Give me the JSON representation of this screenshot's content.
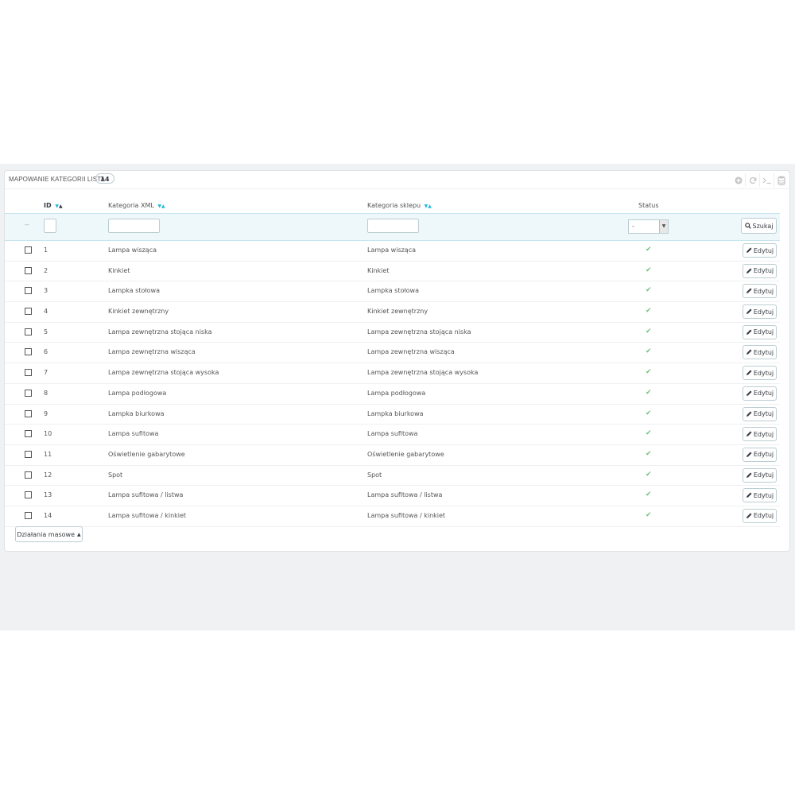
{
  "panel": {
    "title": "Mapowanie kategorii Lista",
    "count": "14"
  },
  "toolbar": {
    "icons": [
      "add-icon",
      "refresh-icon",
      "sql-terminal-icon",
      "database-icon"
    ]
  },
  "columns": {
    "id": "ID",
    "xml": "Kategoria XML",
    "shop": "Kategoria sklepu",
    "status": "Status"
  },
  "filters": {
    "dash": "--",
    "status_value": "-",
    "search_label": "Szukaj"
  },
  "edit_label": "Edytuj",
  "bulk_label": "Działania masowe",
  "colors": {
    "accent": "#25b9d7",
    "status_ok": "#72c279",
    "filter_bg": "#eef8fb"
  },
  "rows": [
    {
      "id": "1",
      "xml": "Lampa wisząca",
      "shop": "Lampa wisząca"
    },
    {
      "id": "2",
      "xml": "Kinkiet",
      "shop": "Kinkiet"
    },
    {
      "id": "3",
      "xml": "Lampka stołowa",
      "shop": "Lampka stołowa"
    },
    {
      "id": "4",
      "xml": "Kinkiet zewnętrzny",
      "shop": "Kinkiet zewnętrzny"
    },
    {
      "id": "5",
      "xml": "Lampa zewnętrzna stojąca niska",
      "shop": "Lampa zewnętrzna stojąca niska"
    },
    {
      "id": "6",
      "xml": "Lampa zewnętrzna wisząca",
      "shop": "Lampa zewnętrzna wisząca"
    },
    {
      "id": "7",
      "xml": "Lampa zewnętrzna stojąca wysoka",
      "shop": "Lampa zewnętrzna stojąca wysoka"
    },
    {
      "id": "8",
      "xml": "Lampa podłogowa",
      "shop": "Lampa podłogowa"
    },
    {
      "id": "9",
      "xml": "Lampka biurkowa",
      "shop": "Lampka biurkowa"
    },
    {
      "id": "10",
      "xml": "Lampa sufitowa",
      "shop": "Lampa sufitowa"
    },
    {
      "id": "11",
      "xml": "Oświetlenie gabarytowe",
      "shop": "Oświetlenie gabarytowe"
    },
    {
      "id": "12",
      "xml": "Spot",
      "shop": "Spot"
    },
    {
      "id": "13",
      "xml": "Lampa sufitowa / listwa",
      "shop": "Lampa sufitowa / listwa"
    },
    {
      "id": "14",
      "xml": "Lampa sufitowa / kinkiet",
      "shop": "Lampa sufitowa / kinkiet"
    }
  ]
}
